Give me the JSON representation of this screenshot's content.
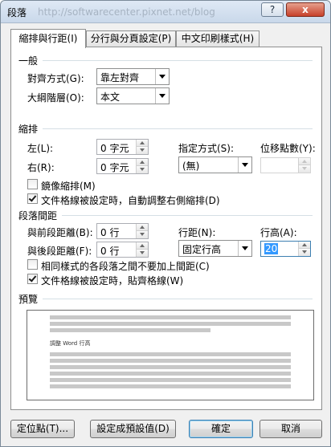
{
  "window": {
    "title": "段落",
    "watermark": "http://softwarecenter.pixnet.net/blog",
    "help_glyph": "?",
    "close_glyph": "x"
  },
  "tabs": [
    {
      "label": "縮排與行距(I)",
      "active": true
    },
    {
      "label": "分行與分頁設定(P)",
      "active": false
    },
    {
      "label": "中文印刷樣式(H)",
      "active": false
    }
  ],
  "general": {
    "heading": "一般",
    "alignment_label": "對齊方式(G):",
    "alignment_value": "靠左對齊",
    "outline_label": "大綱階層(O):",
    "outline_value": "本文"
  },
  "indent": {
    "heading": "縮排",
    "left_label": "左(L):",
    "left_value": "0 字元",
    "right_label": "右(R):",
    "right_value": "0 字元",
    "special_label": "指定方式(S):",
    "special_value": "(無)",
    "by_label": "位移點數(Y):",
    "by_value": "",
    "mirror_label": "鏡像縮排(M)",
    "mirror_checked": false,
    "auto_adjust_label": "文件格線被設定時，自動調整右側縮排(D)",
    "auto_adjust_checked": true
  },
  "spacing": {
    "heading": "段落間距",
    "before_label": "與前段距離(B):",
    "before_value": "0 行",
    "after_label": "與後段距離(F):",
    "after_value": "0 行",
    "line_spacing_label": "行距(N):",
    "line_spacing_value": "固定行高",
    "at_label": "行高(A):",
    "at_value": "20",
    "no_space_label": "相同樣式的各段落之間不要加上間距(C)",
    "no_space_checked": false,
    "snap_grid_label": "文件格線被設定時，貼齊格線(W)",
    "snap_grid_checked": true
  },
  "preview": {
    "heading": "預覽",
    "sample_text": "調整 Word 行高"
  },
  "buttons": {
    "tabs_label": "定位點(T)...",
    "default_label": "設定成預設值(D)",
    "ok_label": "確定",
    "cancel_label": "取消"
  },
  "icons": {
    "dropdown": "dropdown-arrow-icon",
    "spin_up": "spin-up-icon",
    "spin_down": "spin-down-icon",
    "check": "checkmark-icon"
  }
}
